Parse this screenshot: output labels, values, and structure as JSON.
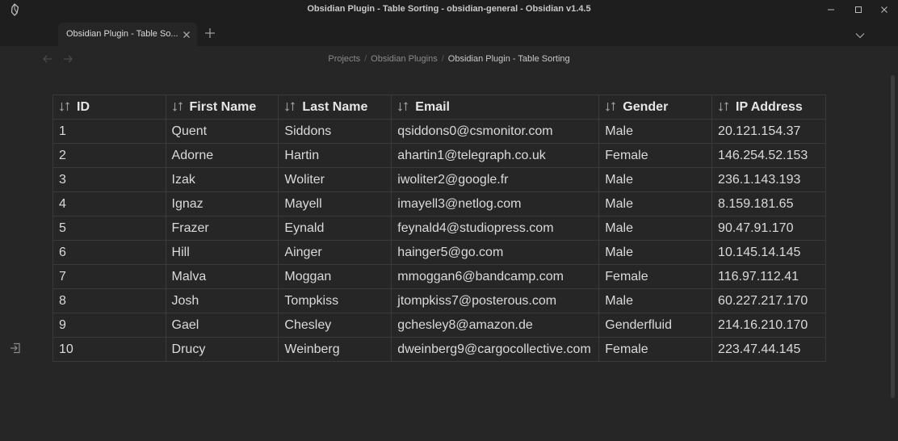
{
  "window": {
    "title": "Obsidian Plugin - Table Sorting - obsidian-general - Obsidian v1.4.5"
  },
  "tabs": [
    {
      "label": "Obsidian Plugin - Table So..."
    }
  ],
  "breadcrumb": {
    "items": [
      "Projects",
      "Obsidian Plugins"
    ],
    "current": "Obsidian Plugin - Table Sorting"
  },
  "table": {
    "headers": [
      "ID",
      "First Name",
      "Last Name",
      "Email",
      "Gender",
      "IP Address"
    ],
    "rows": [
      [
        "1",
        "Quent",
        "Siddons",
        "qsiddons0@csmonitor.com",
        "Male",
        "20.121.154.37"
      ],
      [
        "2",
        "Adorne",
        "Hartin",
        "ahartin1@telegraph.co.uk",
        "Female",
        "146.254.52.153"
      ],
      [
        "3",
        "Izak",
        "Woliter",
        "iwoliter2@google.fr",
        "Male",
        "236.1.143.193"
      ],
      [
        "4",
        "Ignaz",
        "Mayell",
        "imayell3@netlog.com",
        "Male",
        "8.159.181.65"
      ],
      [
        "5",
        "Frazer",
        "Eynald",
        "feynald4@studiopress.com",
        "Male",
        "90.47.91.170"
      ],
      [
        "6",
        "Hill",
        "Ainger",
        "hainger5@go.com",
        "Male",
        "10.145.14.145"
      ],
      [
        "7",
        "Malva",
        "Moggan",
        "mmoggan6@bandcamp.com",
        "Female",
        "116.97.112.41"
      ],
      [
        "8",
        "Josh",
        "Tompkiss",
        "jtompkiss7@posterous.com",
        "Male",
        "60.227.217.170"
      ],
      [
        "9",
        "Gael",
        "Chesley",
        "gchesley8@amazon.de",
        "Genderfluid",
        "214.16.210.170"
      ],
      [
        "10",
        "Drucy",
        "Weinberg",
        "dweinberg9@cargocollective.com",
        "Female",
        "223.47.44.145"
      ]
    ]
  },
  "icons": {
    "app": "obsidian-logo-icon",
    "minimize": "minimize-icon",
    "maximize": "maximize-icon",
    "close": "close-icon",
    "tab_close": "close-icon",
    "new_tab": "plus-icon",
    "tab_list": "chevron-down-icon",
    "back": "arrow-left-icon",
    "forward": "arrow-right-icon",
    "sort": "sort-arrows-icon",
    "sidebar_expand": "sidebar-expand-icon"
  },
  "colors": {
    "background": "#1e1e1e",
    "editor_background": "#262626",
    "table_border": "#3a3a3a",
    "text": "#dadada"
  }
}
